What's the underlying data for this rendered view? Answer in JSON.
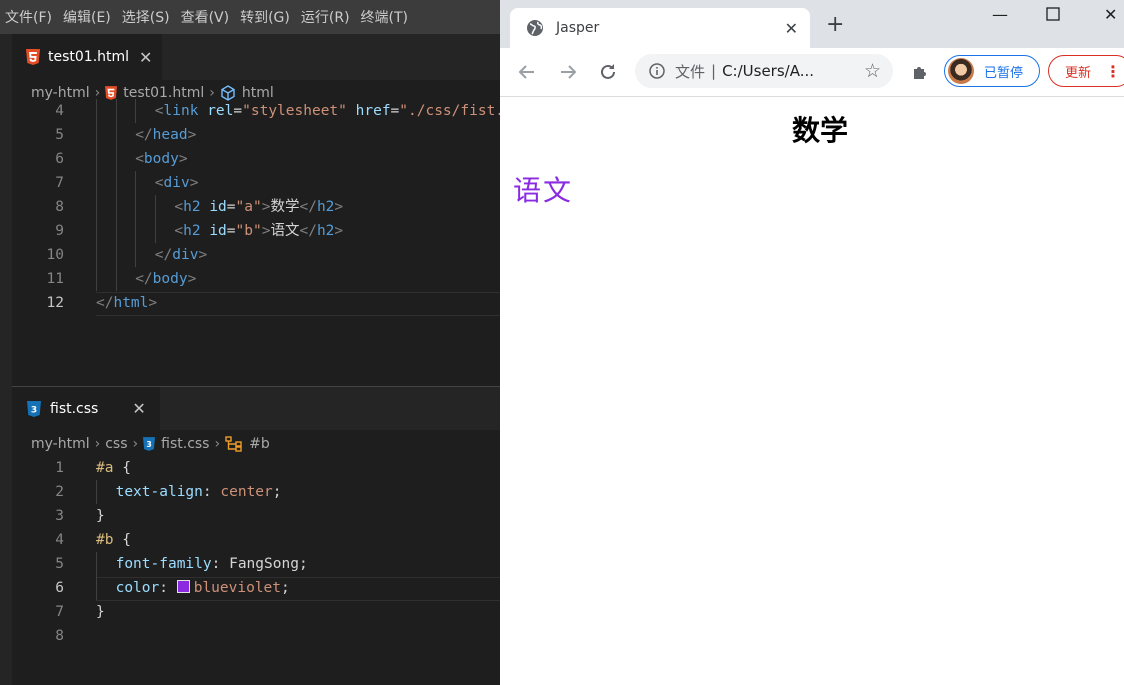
{
  "vscode": {
    "menu": [
      "文件(F)",
      "编辑(E)",
      "选择(S)",
      "查看(V)",
      "转到(G)",
      "运行(R)",
      "终端(T)"
    ],
    "html_editor": {
      "tab_label": "test01.html",
      "breadcrumb": [
        "my-html",
        "test01.html",
        "html"
      ],
      "lines": [
        {
          "n": "4",
          "indent": 3,
          "tokens": [
            [
              "br",
              "<"
            ],
            [
              "tag",
              "link"
            ],
            [
              "txt",
              " "
            ],
            [
              "attr",
              "rel"
            ],
            [
              "txt",
              "="
            ],
            [
              "str",
              "\"stylesheet\""
            ],
            [
              "txt",
              " "
            ],
            [
              "attr",
              "href"
            ],
            [
              "txt",
              "="
            ],
            [
              "str",
              "\"./css/fist.css\""
            ],
            [
              "br",
              ">"
            ]
          ]
        },
        {
          "n": "5",
          "indent": 2,
          "tokens": [
            [
              "br",
              "</"
            ],
            [
              "tag",
              "head"
            ],
            [
              "br",
              ">"
            ]
          ]
        },
        {
          "n": "6",
          "indent": 2,
          "tokens": [
            [
              "br",
              "<"
            ],
            [
              "tag",
              "body"
            ],
            [
              "br",
              ">"
            ]
          ]
        },
        {
          "n": "7",
          "indent": 3,
          "tokens": [
            [
              "br",
              "<"
            ],
            [
              "tag",
              "div"
            ],
            [
              "br",
              ">"
            ]
          ]
        },
        {
          "n": "8",
          "indent": 4,
          "tokens": [
            [
              "br",
              "<"
            ],
            [
              "tag",
              "h2"
            ],
            [
              "txt",
              " "
            ],
            [
              "attr",
              "id"
            ],
            [
              "txt",
              "="
            ],
            [
              "str",
              "\"a\""
            ],
            [
              "br",
              ">"
            ],
            [
              "txt",
              "数学"
            ],
            [
              "br",
              "</"
            ],
            [
              "tag",
              "h2"
            ],
            [
              "br",
              ">"
            ]
          ]
        },
        {
          "n": "9",
          "indent": 4,
          "tokens": [
            [
              "br",
              "<"
            ],
            [
              "tag",
              "h2"
            ],
            [
              "txt",
              " "
            ],
            [
              "attr",
              "id"
            ],
            [
              "txt",
              "="
            ],
            [
              "str",
              "\"b\""
            ],
            [
              "br",
              ">"
            ],
            [
              "txt",
              "语文"
            ],
            [
              "br",
              "</"
            ],
            [
              "tag",
              "h2"
            ],
            [
              "br",
              ">"
            ]
          ]
        },
        {
          "n": "10",
          "indent": 3,
          "tokens": [
            [
              "br",
              "</"
            ],
            [
              "tag",
              "div"
            ],
            [
              "br",
              ">"
            ]
          ]
        },
        {
          "n": "11",
          "indent": 2,
          "tokens": [
            [
              "br",
              "</"
            ],
            [
              "tag",
              "body"
            ],
            [
              "br",
              ">"
            ]
          ]
        },
        {
          "n": "12",
          "indent": 0,
          "active": true,
          "tokens": [
            [
              "br",
              "</"
            ],
            [
              "tag",
              "html"
            ],
            [
              "br",
              ">"
            ]
          ]
        }
      ]
    },
    "css_editor": {
      "tab_label": "fist.css",
      "breadcrumb": [
        "my-html",
        "css",
        "fist.css",
        "#b"
      ],
      "lines": [
        {
          "n": "1",
          "indent": 0,
          "tokens": [
            [
              "sel",
              "#a"
            ],
            [
              "txt",
              " {"
            ]
          ]
        },
        {
          "n": "2",
          "indent": 1,
          "tokens": [
            [
              "prop",
              "text-align"
            ],
            [
              "txt",
              ": "
            ],
            [
              "val",
              "center"
            ],
            [
              "txt",
              ";"
            ]
          ]
        },
        {
          "n": "3",
          "indent": 0,
          "tokens": [
            [
              "txt",
              "}"
            ]
          ]
        },
        {
          "n": "4",
          "indent": 0,
          "tokens": [
            [
              "sel",
              "#b"
            ],
            [
              "txt",
              " {"
            ]
          ]
        },
        {
          "n": "5",
          "indent": 1,
          "tokens": [
            [
              "prop",
              "font-family"
            ],
            [
              "txt",
              ": "
            ],
            [
              "txt",
              "FangSong"
            ],
            [
              "txt",
              ";"
            ]
          ]
        },
        {
          "n": "6",
          "indent": 1,
          "active": true,
          "tokens": [
            [
              "prop",
              "color"
            ],
            [
              "txt",
              ": "
            ],
            [
              "swatch",
              "#8a2be2"
            ],
            [
              "val",
              "blueviolet"
            ],
            [
              "txt",
              ";"
            ]
          ]
        },
        {
          "n": "7",
          "indent": 0,
          "tokens": [
            [
              "txt",
              "}"
            ]
          ]
        },
        {
          "n": "8",
          "indent": 0,
          "tokens": []
        }
      ]
    }
  },
  "browser": {
    "tab_title": "Jasper",
    "new_tab": "+",
    "omnibox": {
      "scheme": "文件",
      "separator": "|",
      "url": "C:/Users/A..."
    },
    "profile_label": "已暂停",
    "update_label": "更新",
    "page": {
      "h2_a": "数学",
      "h2_b": "语文"
    }
  },
  "colors": {
    "blueviolet": "#8a2be2",
    "html5_orange": "#e44d26",
    "css3_blue": "#1572b6"
  }
}
